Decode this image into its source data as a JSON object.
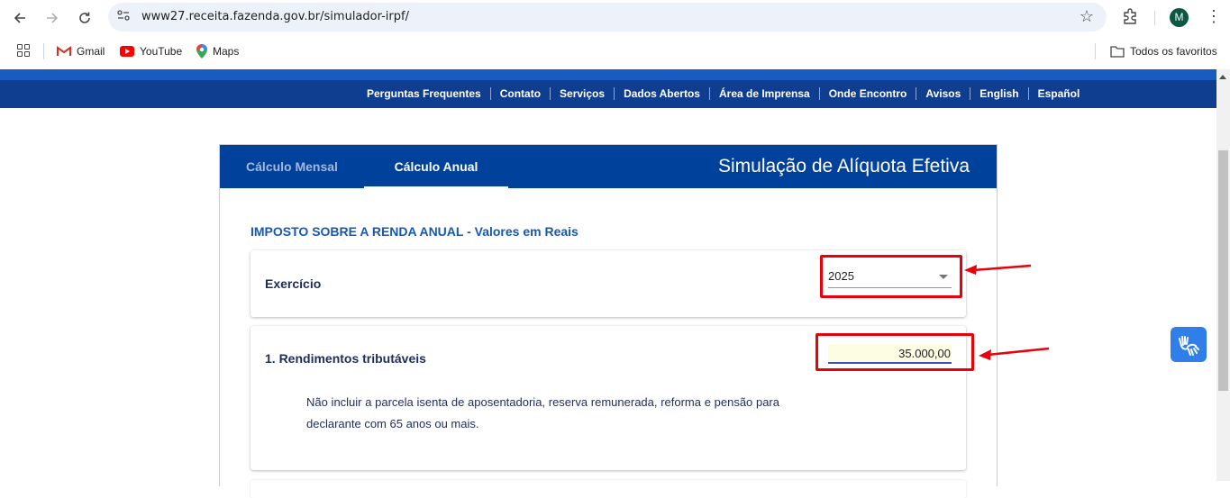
{
  "browser": {
    "url": "www27.receita.fazenda.gov.br/simulador-irpf/",
    "profile_initial": "M",
    "bookmarks": [
      {
        "label": "Gmail",
        "icon": "gmail-icon"
      },
      {
        "label": "YouTube",
        "icon": "youtube-icon"
      },
      {
        "label": "Maps",
        "icon": "maps-icon"
      }
    ],
    "all_bookmarks_label": "Todos os favoritos"
  },
  "site_nav": {
    "items": [
      "Perguntas Frequentes",
      "Contato",
      "Serviços",
      "Dados Abertos",
      "Área de Imprensa",
      "Onde Encontro",
      "Avisos",
      "English",
      "Español"
    ]
  },
  "panel": {
    "tabs": [
      {
        "label": "Cálculo Mensal",
        "active": false
      },
      {
        "label": "Cálculo Anual",
        "active": true
      }
    ],
    "title": "Simulação de Alíquota Efetiva",
    "section_title": "IMPOSTO SOBRE A RENDA ANUAL - Valores em Reais",
    "exercicio": {
      "label": "Exercício",
      "selected": "2025"
    },
    "rendimentos": {
      "label": "1. Rendimentos tributáveis",
      "value": "35.000,00",
      "note": "Não incluir a parcela isenta de aposentadoria, reserva remunerada, reforma e pensão para declarante com 65 anos ou mais."
    }
  },
  "colors": {
    "header_blue": "#00419b",
    "nav_blue": "#0f3e91",
    "accent_blue": "#1559b5",
    "highlight_red": "#e8000b"
  }
}
